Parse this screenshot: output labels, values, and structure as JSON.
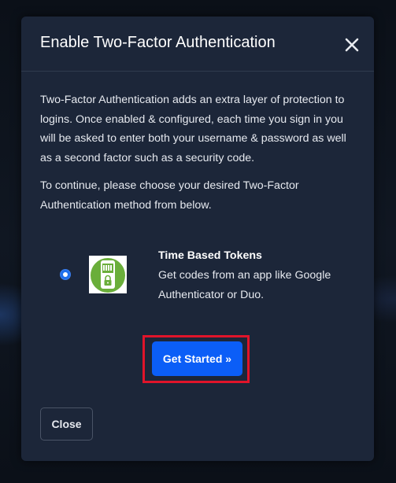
{
  "modal": {
    "title": "Enable Two-Factor Authentication",
    "intro_text": "Two-Factor Authentication adds an extra layer of protection to logins. Once enabled & configured, each time you sign in you will be asked to enter both your username & password as well as a second factor such as a security code.",
    "choose_text": "To continue, please choose your desired Two-Factor Authentication method from below."
  },
  "method": {
    "selected": true,
    "icon": "time-based-token-phone-icon",
    "title": "Time Based Tokens",
    "description": "Get codes from an app like Google Authenticator or Duo."
  },
  "buttons": {
    "primary_label": "Get Started »",
    "secondary_label": "Close"
  },
  "colors": {
    "modal_bg": "#1c2639",
    "primary_button": "#0b5ef7",
    "highlight_border": "#e0142a",
    "icon_green": "#6aae3a"
  }
}
